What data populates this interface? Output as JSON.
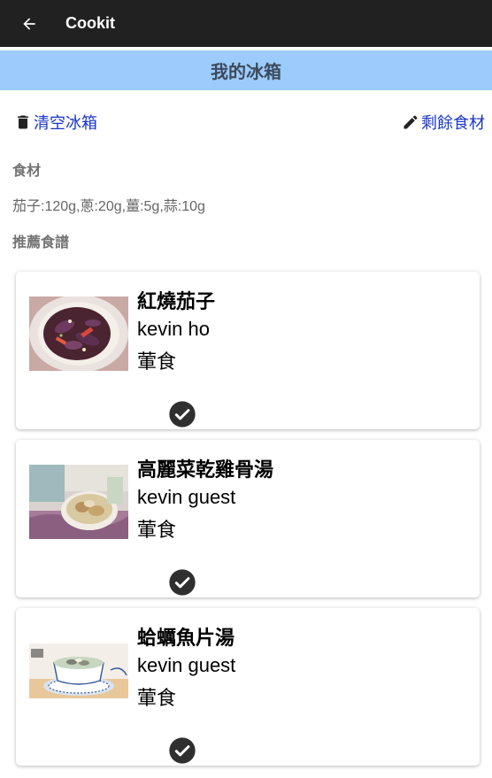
{
  "appbar": {
    "title": "Cookit",
    "back_icon": "arrow-left-icon"
  },
  "header": {
    "title": "我的冰箱",
    "background": "#9ccbfc"
  },
  "actions": {
    "clear_label": "清空冰箱",
    "clear_icon": "trash-icon",
    "remaining_label": "剩餘食材",
    "remaining_icon": "pencil-icon",
    "link_color": "#1a35c4"
  },
  "ingredients": {
    "label": "食材",
    "text": "茄子:120g,蔥:20g,薑:5g,蒜:10g"
  },
  "recommended": {
    "label": "推薦食譜"
  },
  "recipes": [
    {
      "title": "紅燒茄子",
      "author": "kevin ho",
      "diet": "葷食",
      "image_icon": "braised-eggplant-photo",
      "check_icon": "check-circle-icon"
    },
    {
      "title": "高麗菜乾雞骨湯",
      "author": "kevin guest",
      "diet": "葷食",
      "image_icon": "chicken-soup-photo",
      "check_icon": "check-circle-icon"
    },
    {
      "title": "蛤蠣魚片湯",
      "author": "kevin guest",
      "diet": "葷食",
      "image_icon": "clam-fish-soup-photo",
      "check_icon": "check-circle-icon"
    }
  ]
}
